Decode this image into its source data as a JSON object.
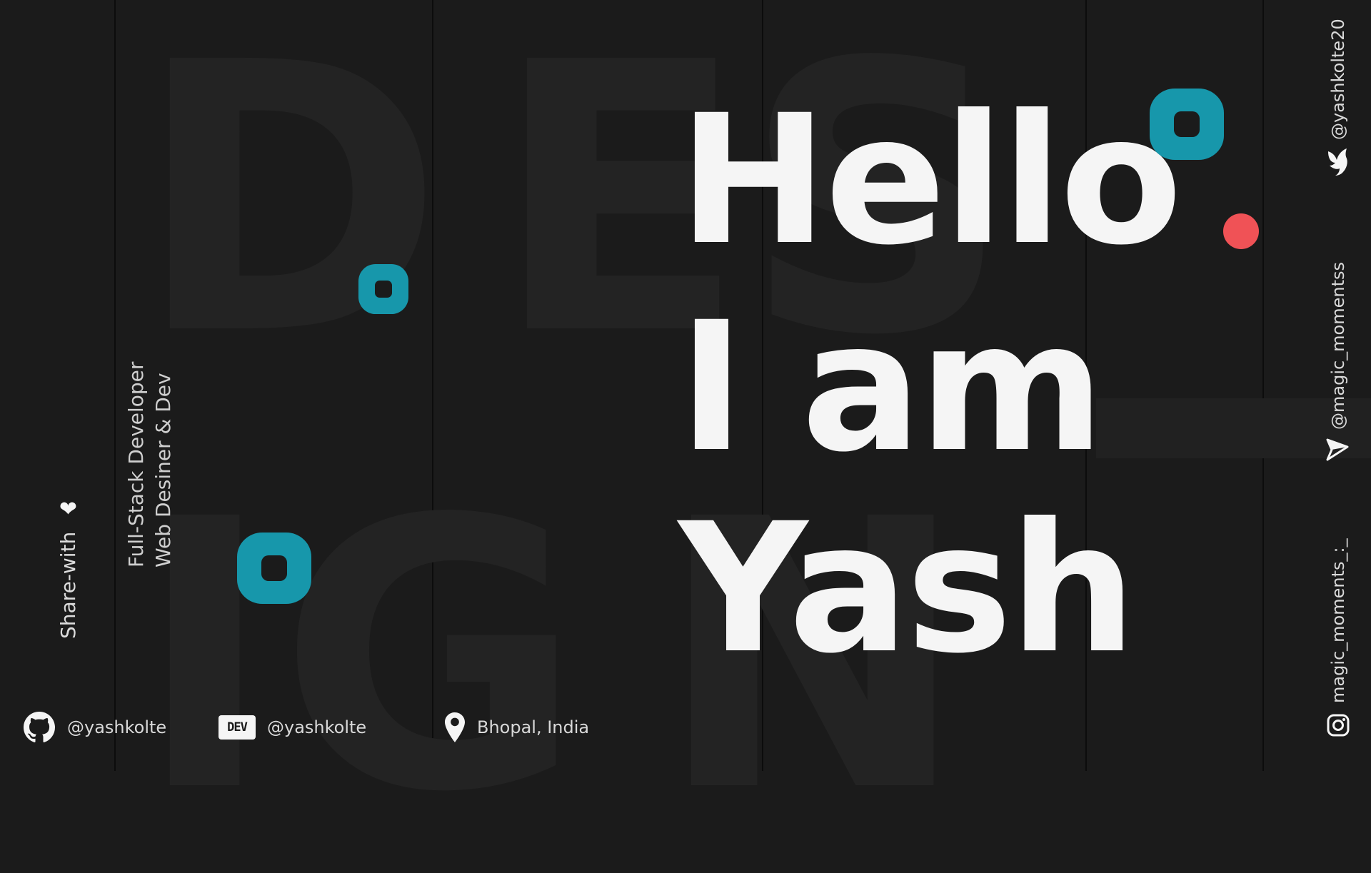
{
  "colors": {
    "background": "#1b1b1b",
    "accent_teal": "#1797ab",
    "accent_red": "#f05256",
    "text_main": "#f5f5f5"
  },
  "background_word": {
    "letters": [
      "D",
      "E",
      "S",
      "I",
      "G",
      "N"
    ]
  },
  "hero": {
    "line1": "Hello",
    "line2": "I am",
    "line3": "Yash"
  },
  "sidebar_left": {
    "share_label": "Share-with",
    "heart_icon": "heart-icon",
    "role_line1": "Full-Stack Developer",
    "role_line2": "Web Desiner & Dev"
  },
  "footer": {
    "github": {
      "icon": "github-icon",
      "handle": "@yashkolte"
    },
    "dev": {
      "icon": "dev-icon",
      "badge": "DEV",
      "handle": "@yashkolte"
    },
    "location": {
      "icon": "location-pin-icon",
      "text": "Bhopal, India"
    }
  },
  "sidebar_right": {
    "twitter": {
      "icon": "bird-icon",
      "handle": "@yashkolte20"
    },
    "telegram": {
      "icon": "send-icon",
      "handle": "@magic_momentss"
    },
    "instagram": {
      "icon": "instagram-icon",
      "handle": "magic_moments_:_"
    }
  }
}
